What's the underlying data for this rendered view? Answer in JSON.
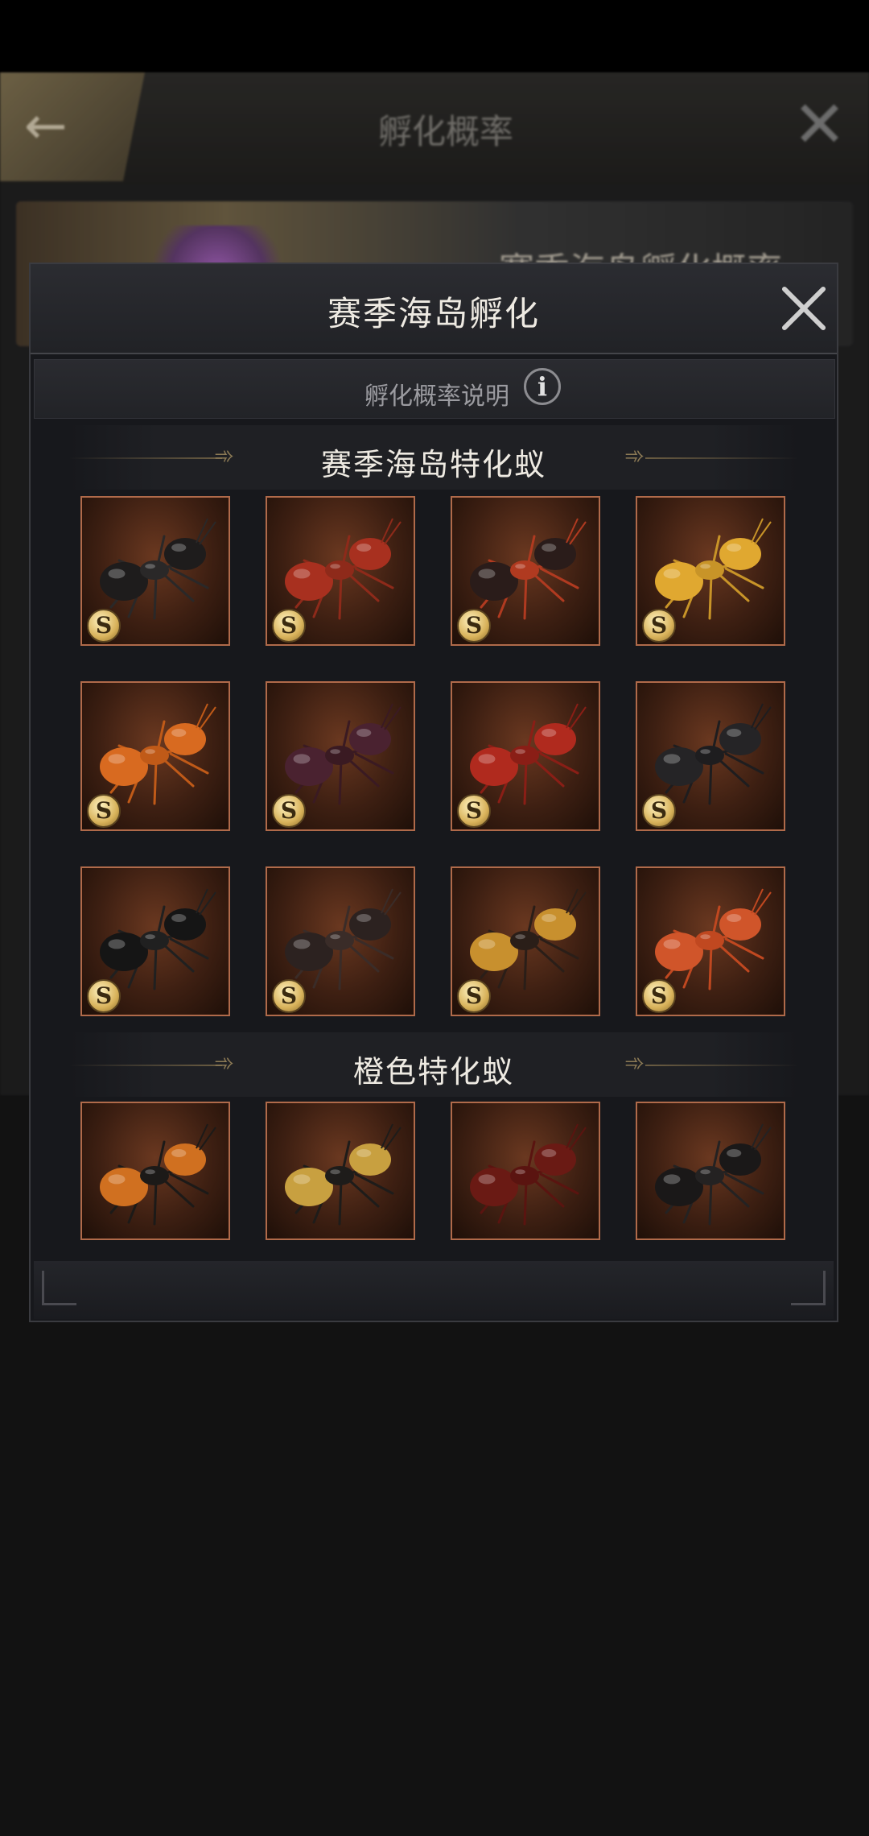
{
  "background": {
    "title": "孵化概率",
    "banner_text": "赛季海岛孵化概率"
  },
  "modal": {
    "title": "赛季海岛孵化",
    "probability_label": "孵化概率说明",
    "info_glyph": "i"
  },
  "sections": [
    {
      "title": "赛季海岛特化蚁",
      "badge": "S",
      "ants": [
        {
          "name": "black-ant",
          "body": "#1e1c1c",
          "head": "#2a2828"
        },
        {
          "name": "red-ant",
          "body": "#a8301f",
          "head": "#8e2a1a"
        },
        {
          "name": "red-black-ant",
          "body": "#2a1c1a",
          "head": "#b03a20"
        },
        {
          "name": "yellow-ant",
          "body": "#e0a830",
          "head": "#c89428"
        },
        {
          "name": "orange-ant",
          "body": "#d86a20",
          "head": "#c05a18"
        },
        {
          "name": "purple-black-ant",
          "body": "#4a2230",
          "head": "#3a1a22"
        },
        {
          "name": "crimson-ant",
          "body": "#b02a1e",
          "head": "#8a1e16"
        },
        {
          "name": "dark-ant",
          "body": "#252426",
          "head": "#1e1d1f"
        },
        {
          "name": "glossy-black-ant",
          "body": "#151515",
          "head": "#202020"
        },
        {
          "name": "brown-black-ant",
          "body": "#2c2220",
          "head": "#3a2c28"
        },
        {
          "name": "amber-ant",
          "body": "#c8902e",
          "head": "#2a1e18"
        },
        {
          "name": "rust-ant",
          "body": "#d0552a",
          "head": "#c04820"
        }
      ]
    },
    {
      "title": "橙色特化蚁",
      "badge": "",
      "ants": [
        {
          "name": "orange-black-ant",
          "body": "#d07020",
          "head": "#1c1a18"
        },
        {
          "name": "gold-black-ant",
          "body": "#c8a040",
          "head": "#1e1c1a"
        },
        {
          "name": "maroon-ant",
          "body": "#6a1a14",
          "head": "#5a1410"
        },
        {
          "name": "slim-black-ant",
          "body": "#1a1818",
          "head": "#242222"
        }
      ]
    }
  ]
}
